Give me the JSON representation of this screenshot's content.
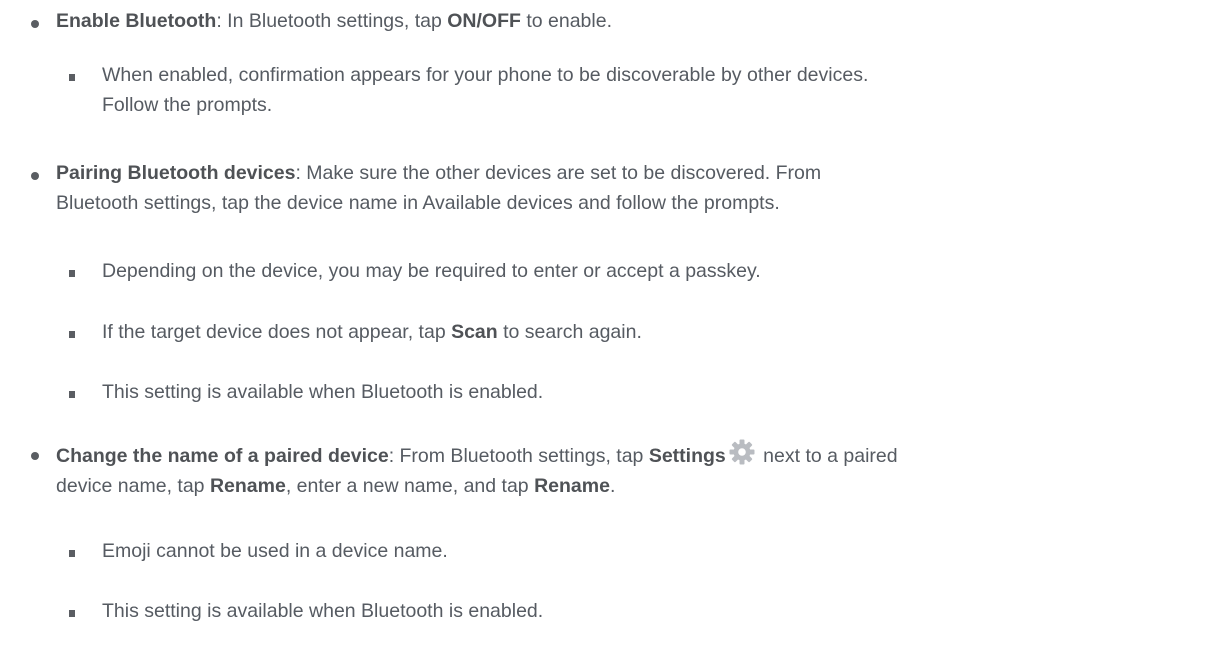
{
  "items": [
    {
      "level": 1,
      "title": "Enable Bluetooth",
      "t1": ": In Bluetooth settings, tap ",
      "b1": "ON/OFF",
      "t2": " to enable."
    },
    {
      "level": 2,
      "line1": "When enabled, confirmation appears for your phone to be discoverable by other devices.",
      "line2": "Follow the prompts."
    },
    {
      "level": 1,
      "title": "Pairing Bluetooth devices",
      "line1": ": Make sure the other devices are set to be discovered. From",
      "line2": "Bluetooth settings, tap the device name in Available devices and follow the prompts."
    },
    {
      "level": 2,
      "text": "Depending on the device, you may be required to enter or accept a passkey."
    },
    {
      "level": 2,
      "t1": "If the target device does not appear, tap ",
      "b1": "Scan",
      "t2": " to search again."
    },
    {
      "level": 2,
      "text": "This setting is available when Bluetooth is enabled."
    },
    {
      "level": 1,
      "title": "Change the name of a paired device",
      "t1": ": From Bluetooth settings, tap ",
      "b1": "Settings",
      "t2": " next to a paired",
      "t3": "device name, tap ",
      "b2": "Rename",
      "t4": ", enter a new name, and tap ",
      "b3": "Rename",
      "t5": ".",
      "icon": "gear-icon",
      "icon_color": "#b9bcc1"
    },
    {
      "level": 2,
      "text": "Emoji cannot be used in a device name."
    },
    {
      "level": 2,
      "text": "This setting is available when Bluetooth is enabled."
    }
  ],
  "colors": {
    "text": "#565b62",
    "bullet": "#5a5d62",
    "background": "#ffffff"
  }
}
